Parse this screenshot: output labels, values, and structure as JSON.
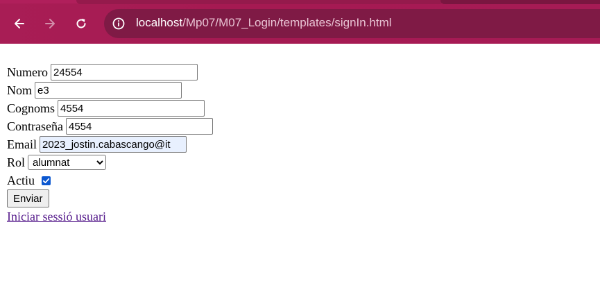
{
  "browser": {
    "url_host": "localhost",
    "url_path": "/Mp07/M07_Login/templates/signIn.html",
    "icons": [
      "back-arrow-icon",
      "forward-arrow-icon",
      "reload-icon",
      "site-info-icon"
    ]
  },
  "form": {
    "numero": {
      "label": "Numero",
      "value": "24554"
    },
    "nom": {
      "label": "Nom",
      "value": "e3"
    },
    "cognoms": {
      "label": "Cognoms",
      "value": "4554"
    },
    "contrasena": {
      "label": "Contraseña",
      "value": "4554"
    },
    "email": {
      "label": "Email",
      "value": "2023_jostin.cabascango@it"
    },
    "rol": {
      "label": "Rol",
      "selected": "alumnat"
    },
    "actiu": {
      "label": "Actiu",
      "checked": true
    },
    "submit_label": "Enviar",
    "login_link": "Iniciar sessió usuari"
  }
}
